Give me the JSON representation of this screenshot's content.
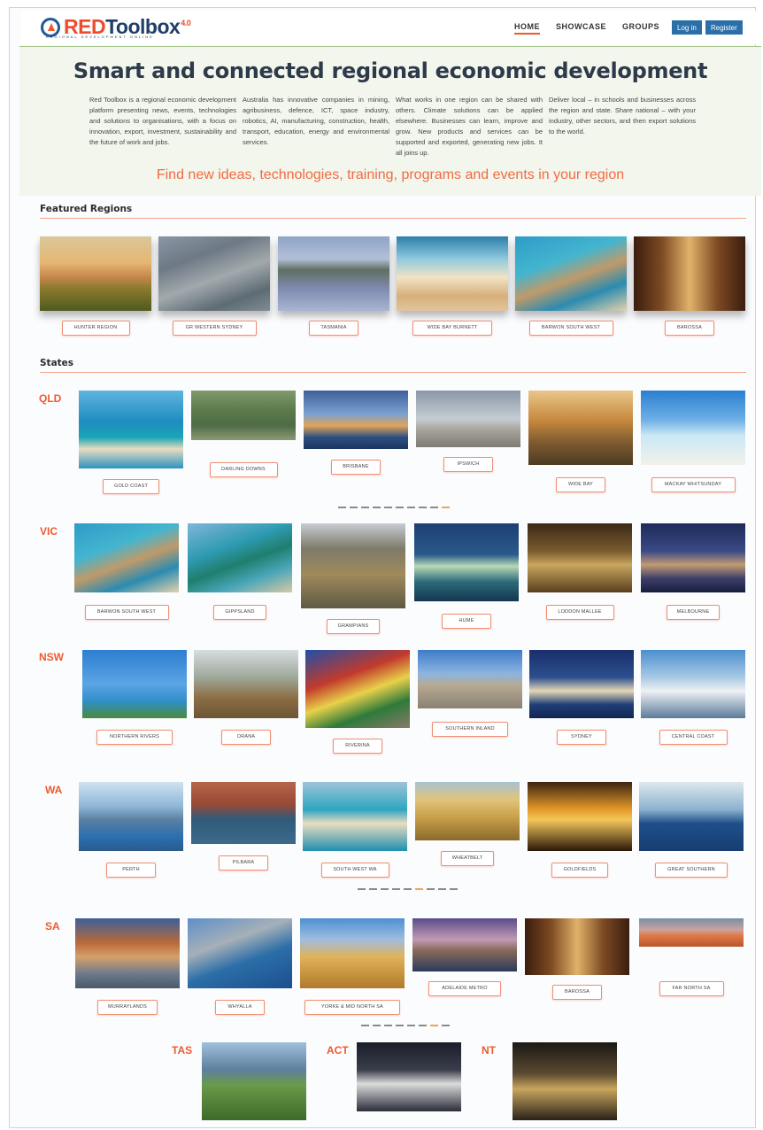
{
  "brand": {
    "name_red": "RED",
    "name_rest": "Toolbox",
    "version": "4.0",
    "tagline": "REGIONAL DEVELOPMENT ONLINE",
    "accent": "#ef5a2d"
  },
  "nav": {
    "items": [
      {
        "label": "HOME",
        "active": true
      },
      {
        "label": "SHOWCASE",
        "active": false
      },
      {
        "label": "GROUPS",
        "active": false
      }
    ],
    "login": "Log in",
    "register": "Register"
  },
  "hero": {
    "title": "Smart and connected regional economic development",
    "columns": [
      "Red Toolbox is a regional economic development platform presenting news, events, technologies and solutions to organisations, with a focus on innovation, export, investment, sustainability and the future of work and jobs.",
      "Australia has innovative companies in mining, agribusiness, defence, ICT, space industry, robotics, AI, manufacturing, construction, health, transport, education, energy and environmental services.",
      "What works in one region can be shared with others. Climate solutions can be applied elsewhere. Businesses can learn, improve and grow. New products and services can be supported and exported, generating new jobs. It all joins up.",
      "Deliver local – in schools and businesses across the region and state. Share national – with your industry, other sectors, and then export solutions to the world."
    ],
    "tagline": "Find new ideas, technologies, training, programs and events in your region"
  },
  "featured": {
    "title": "Featured Regions",
    "regions": [
      "HUNTER REGION",
      "GR WESTERN SYDNEY",
      "TASMANIA",
      "WIDE BAY BURNETT",
      "BARWON SOUTH WEST",
      "BAROSSA"
    ]
  },
  "states": {
    "title": "States",
    "groups": [
      {
        "state": "QLD",
        "regions": [
          "GOLD COAST",
          "DARLING DOWNS",
          "BRISBANE",
          "IPSWICH",
          "WIDE BAY",
          "MACKAY WHITSUNDAY"
        ]
      },
      {
        "state": "VIC",
        "regions": [
          "BARWON SOUTH WEST",
          "GIPPSLAND",
          "GRAMPIANS",
          "HUME",
          "LODDON MALLEE",
          "MELBOURNE"
        ]
      },
      {
        "state": "NSW",
        "regions": [
          "NORTHERN RIVERS",
          "ORANA",
          "RIVERINA",
          "SOUTHERN INLAND",
          "SYDNEY",
          "CENTRAL COAST"
        ]
      },
      {
        "state": "WA",
        "regions": [
          "PERTH",
          "PILBARA",
          "SOUTH WEST WA",
          "WHEATBELT",
          "GOLDFIELDS",
          "GREAT SOUTHERN"
        ]
      },
      {
        "state": "SA",
        "regions": [
          "MURRAYLANDS",
          "WHYALLA",
          "YORKE & MID NORTH SA",
          "ADELAIDE METRO",
          "BAROSSA",
          "FAR NORTH SA"
        ]
      }
    ],
    "territories": [
      "TAS",
      "ACT",
      "NT"
    ]
  }
}
